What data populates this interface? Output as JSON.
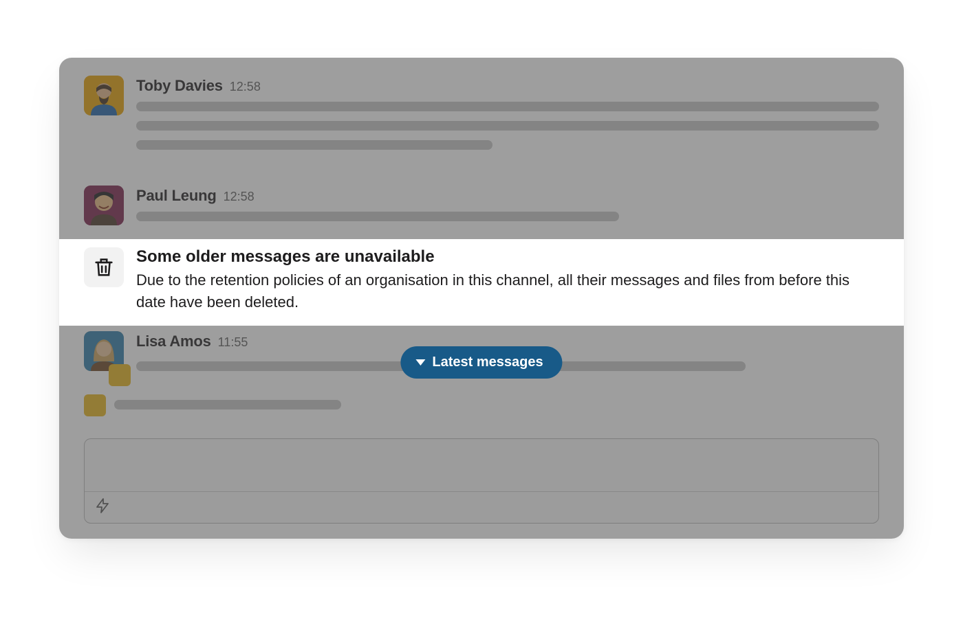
{
  "messages": [
    {
      "name": "Toby Davies",
      "time": "12:58"
    },
    {
      "name": "Paul Leung",
      "time": "12:58"
    },
    {
      "name": "Lisa Amos",
      "time": "11:55"
    }
  ],
  "notice": {
    "title": "Some older messages are unavailable",
    "body": "Due to the retention policies of an organisation in this channel, all their messages and files from before this date have been deleted."
  },
  "pill": {
    "label": "Latest messages"
  }
}
